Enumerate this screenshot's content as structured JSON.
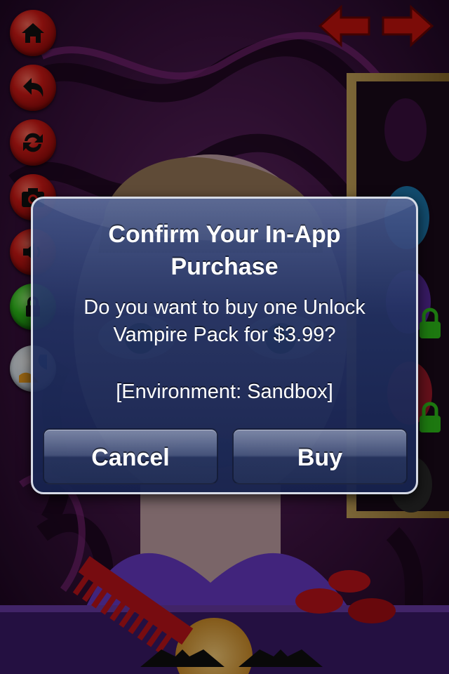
{
  "dialog": {
    "title": "Confirm Your In-App Purchase",
    "message": "Do you want to buy one Unlock Vampire Pack for $3.99?",
    "environment": "[Environment: Sandbox]",
    "cancel_label": "Cancel",
    "buy_label": "Buy"
  },
  "game": {
    "side_buttons": [
      "home-icon",
      "back-icon",
      "refresh-icon",
      "camera-icon",
      "sound-icon",
      "lock-icon",
      "ball-icon"
    ],
    "nav_arrows": [
      "arrow-left-icon",
      "arrow-right-icon"
    ],
    "colors": {
      "button_red": "#d41a16",
      "lock_green": "#2fc21b",
      "background_purple": "#5a1a6a",
      "dialog_blue": "#22316e"
    }
  }
}
